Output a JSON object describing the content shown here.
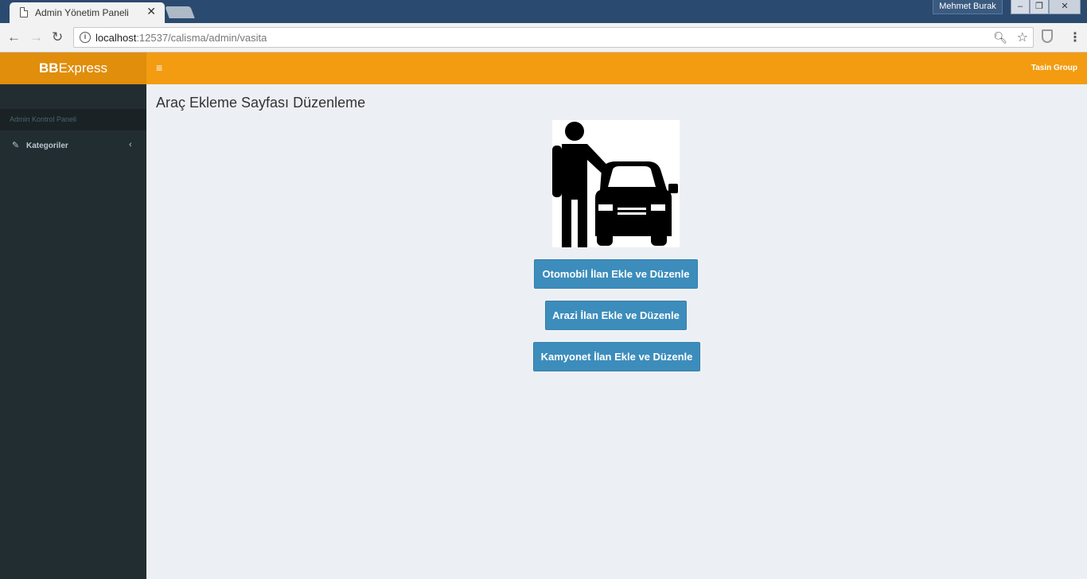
{
  "browser": {
    "tab_title": "Admin Yönetim Paneli",
    "tab_close": "✕",
    "user_name": "Mehmet Burak",
    "url_host": "localhost",
    "url_rest": ":12537/calisma/admin/vasita",
    "win_min": "–",
    "win_max": "❐",
    "win_close": "✕"
  },
  "header": {
    "logo_bold": "BB",
    "logo_rest": "Express",
    "hamburger": "≡",
    "user_label": "Tasin Group"
  },
  "sidebar": {
    "header": "Admin Kontrol Paneli",
    "items": [
      {
        "label": "Kategoriler",
        "icon": "edit-icon"
      }
    ]
  },
  "main": {
    "title": "Araç Ekleme Sayfası Düzenleme",
    "illustration": "person-with-car-icon",
    "buttons": [
      {
        "label": "Otomobil İlan Ekle ve Düzenle"
      },
      {
        "label": "Arazi İlan Ekle ve Düzenle"
      },
      {
        "label": "Kamyonet İlan Ekle ve Düzenle"
      }
    ]
  },
  "colors": {
    "navbar": "#f39c12",
    "logo_bg": "#e08e0b",
    "sidebar": "#222d32",
    "button": "#3c8dbc",
    "content_bg": "#ecf0f5"
  }
}
